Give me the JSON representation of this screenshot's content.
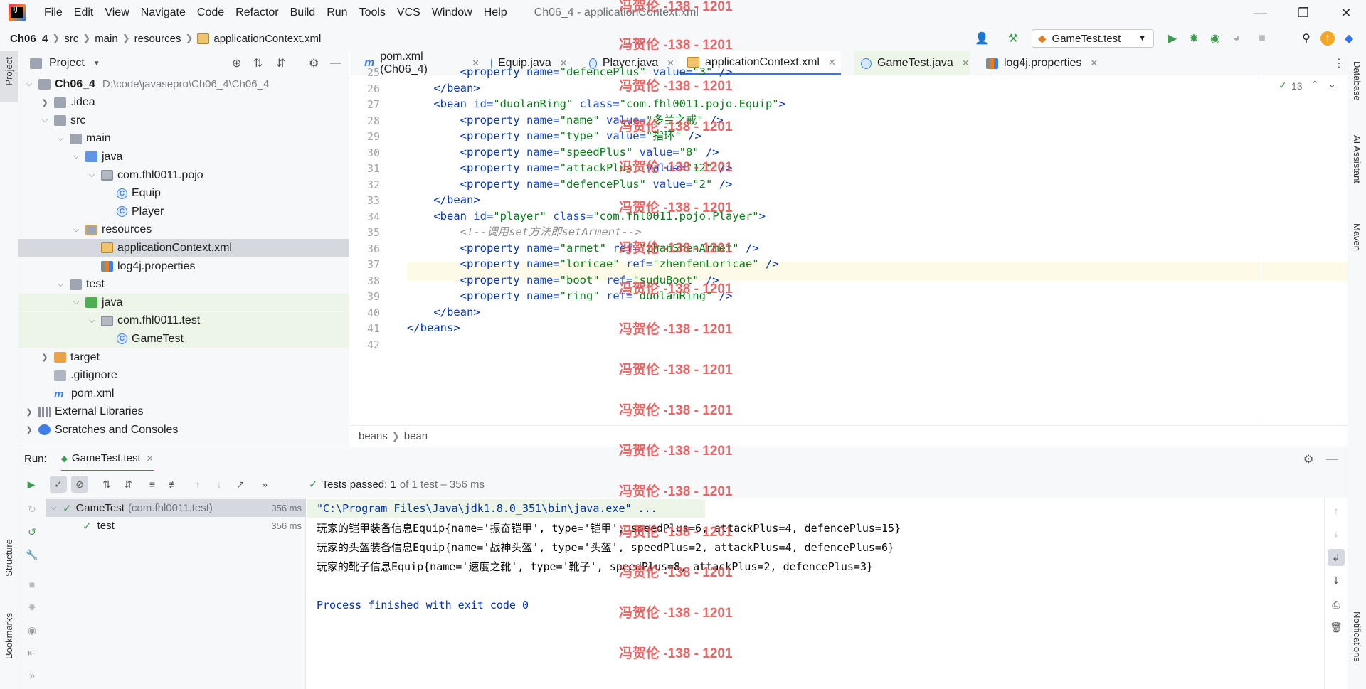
{
  "menubar": {
    "logo": "IJ",
    "items": [
      "File",
      "Edit",
      "View",
      "Navigate",
      "Code",
      "Refactor",
      "Build",
      "Run",
      "Tools",
      "VCS",
      "Window",
      "Help"
    ],
    "window_title": "Ch06_4 - applicationContext.xml"
  },
  "breadcrumb": [
    "Ch06_4",
    "src",
    "main",
    "resources",
    "applicationContext.xml"
  ],
  "toolbar": {
    "run_config": "GameTest.test"
  },
  "project_panel": {
    "title": "Project",
    "tree": [
      {
        "label": "Ch06_4",
        "extra": "D:\\code\\javasepro\\Ch06_4\\Ch06_4"
      },
      {
        "label": ".idea"
      },
      {
        "label": "src"
      },
      {
        "label": "main"
      },
      {
        "label": "java"
      },
      {
        "label": "com.fhl0011.pojo"
      },
      {
        "label": "Equip"
      },
      {
        "label": "Player"
      },
      {
        "label": "resources"
      },
      {
        "label": "applicationContext.xml"
      },
      {
        "label": "log4j.properties"
      },
      {
        "label": "test"
      },
      {
        "label": "java"
      },
      {
        "label": "com.fhl0011.test"
      },
      {
        "label": "GameTest"
      },
      {
        "label": "target"
      },
      {
        "label": ".gitignore"
      },
      {
        "label": "pom.xml"
      },
      {
        "label": "External Libraries"
      },
      {
        "label": "Scratches and Consoles"
      }
    ]
  },
  "editor_tabs": [
    {
      "label": "pom.xml (Ch06_4)"
    },
    {
      "label": "Equip.java"
    },
    {
      "label": "Player.java"
    },
    {
      "label": "applicationContext.xml"
    },
    {
      "label": "GameTest.java"
    },
    {
      "label": "log4j.properties"
    }
  ],
  "editor": {
    "problems_count": "13",
    "line_numbers": [
      "25",
      "26",
      "27",
      "28",
      "29",
      "30",
      "31",
      "32",
      "33",
      "34",
      "35",
      "36",
      "37",
      "38",
      "39",
      "40",
      "41",
      "42"
    ],
    "lines": [
      {
        "indent": "        ",
        "parts": [
          [
            "tag",
            "<property "
          ],
          [
            "attr",
            "name="
          ],
          [
            "val",
            "\"defencePlus\" "
          ],
          [
            "attr",
            "value="
          ],
          [
            "val",
            "\"3\""
          ],
          [
            "tag",
            " />"
          ]
        ]
      },
      {
        "indent": "    ",
        "parts": [
          [
            "tag",
            "</bean>"
          ]
        ]
      },
      {
        "indent": "    ",
        "parts": [
          [
            "tag",
            "<bean "
          ],
          [
            "attr",
            "id="
          ],
          [
            "val",
            "\"duolanRing\" "
          ],
          [
            "attr",
            "class="
          ],
          [
            "val",
            "\"com.fhl0011.pojo.Equip\""
          ],
          [
            "tag",
            ">"
          ]
        ]
      },
      {
        "indent": "        ",
        "parts": [
          [
            "tag",
            "<property "
          ],
          [
            "attr",
            "name="
          ],
          [
            "val",
            "\"name\" "
          ],
          [
            "attr",
            "value="
          ],
          [
            "val",
            "\"多兰之戒\""
          ],
          [
            "tag",
            " />"
          ]
        ]
      },
      {
        "indent": "        ",
        "parts": [
          [
            "tag",
            "<property "
          ],
          [
            "attr",
            "name="
          ],
          [
            "val",
            "\"type\" "
          ],
          [
            "attr",
            "value="
          ],
          [
            "val",
            "\"指环\""
          ],
          [
            "tag",
            " />"
          ]
        ]
      },
      {
        "indent": "        ",
        "parts": [
          [
            "tag",
            "<property "
          ],
          [
            "attr",
            "name="
          ],
          [
            "val",
            "\"speedPlus\" "
          ],
          [
            "attr",
            "value="
          ],
          [
            "val",
            "\"8\""
          ],
          [
            "tag",
            " />"
          ]
        ]
      },
      {
        "indent": "        ",
        "parts": [
          [
            "tag",
            "<property "
          ],
          [
            "attr",
            "name="
          ],
          [
            "val",
            "\"attackPlus\" "
          ],
          [
            "attr",
            "value="
          ],
          [
            "val",
            "\"12\""
          ],
          [
            "tag",
            " />"
          ]
        ]
      },
      {
        "indent": "        ",
        "parts": [
          [
            "tag",
            "<property "
          ],
          [
            "attr",
            "name="
          ],
          [
            "val",
            "\"defencePlus\" "
          ],
          [
            "attr",
            "value="
          ],
          [
            "val",
            "\"2\""
          ],
          [
            "tag",
            " />"
          ]
        ]
      },
      {
        "indent": "    ",
        "parts": [
          [
            "tag",
            "</bean>"
          ]
        ]
      },
      {
        "indent": "    ",
        "parts": [
          [
            "tag",
            "<bean "
          ],
          [
            "attr",
            "id="
          ],
          [
            "val",
            "\"player\" "
          ],
          [
            "attr",
            "class="
          ],
          [
            "val",
            "\"com.fhl0011.pojo.Player\""
          ],
          [
            "tag",
            ">"
          ]
        ]
      },
      {
        "indent": "        ",
        "parts": [
          [
            "cmt",
            "<!--调用set方法即setArment-->"
          ]
        ]
      },
      {
        "indent": "        ",
        "parts": [
          [
            "tag",
            "<property "
          ],
          [
            "attr",
            "name="
          ],
          [
            "val",
            "\"armet\" "
          ],
          [
            "attr",
            "ref="
          ],
          [
            "val",
            "\"zhanShenArmet\""
          ],
          [
            "tag",
            " />"
          ]
        ]
      },
      {
        "indent": "        ",
        "parts": [
          [
            "tag",
            "<property "
          ],
          [
            "attr",
            "name="
          ],
          [
            "val",
            "\"loricae\" "
          ],
          [
            "attr",
            "ref="
          ],
          [
            "val",
            "\"zhenfenLoricae\""
          ],
          [
            "tag",
            " />"
          ]
        ]
      },
      {
        "indent": "        ",
        "parts": [
          [
            "tag",
            "<property "
          ],
          [
            "attr",
            "name="
          ],
          [
            "val",
            "\"boot\" "
          ],
          [
            "attr",
            "ref="
          ],
          [
            "val",
            "\"suduBoot\""
          ],
          [
            "tag",
            " />"
          ]
        ]
      },
      {
        "indent": "        ",
        "parts": [
          [
            "tag",
            "<property "
          ],
          [
            "attr",
            "name="
          ],
          [
            "val",
            "\"ring\" "
          ],
          [
            "attr",
            "ref="
          ],
          [
            "val",
            "\"duolanRing\""
          ],
          [
            "tag",
            " />"
          ]
        ]
      },
      {
        "indent": "    ",
        "parts": [
          [
            "tag",
            "</bean>"
          ]
        ]
      },
      {
        "indent": "",
        "parts": [
          [
            "tag",
            "</beans>"
          ]
        ]
      },
      {
        "indent": "",
        "parts": []
      }
    ],
    "breadcrumbs": [
      "beans",
      "bean"
    ]
  },
  "watermark": "冯贺伦 -138 - 1201",
  "run_panel": {
    "label": "Run:",
    "tab": "GameTest.test",
    "status_bold": "Tests passed: 1",
    "status_rest": "of 1 test – 356 ms",
    "tests": [
      {
        "name": "GameTest",
        "class": "(com.fhl0011.test)",
        "time": "356 ms"
      },
      {
        "name": "test",
        "time": "356 ms"
      }
    ],
    "console": [
      "\"C:\\Program Files\\Java\\jdk1.8.0_351\\bin\\java.exe\" ...",
      "玩家的铠甲装备信息Equip{name='振奋铠甲', type='铠甲', speedPlus=6, attackPlus=4, defencePlus=15}",
      "玩家的头盔装备信息Equip{name='战神头盔', type='头盔', speedPlus=2, attackPlus=4, defencePlus=6}",
      "玩家的靴子信息Equip{name='速度之靴', type='靴子', speedPlus=8, attackPlus=2, defencePlus=3}",
      "",
      "Process finished with exit code 0"
    ]
  },
  "side_tools": {
    "left": [
      "Project",
      "Structure",
      "Bookmarks"
    ],
    "right": [
      "Database",
      "AI Assistant",
      "Maven",
      "Notifications"
    ]
  }
}
